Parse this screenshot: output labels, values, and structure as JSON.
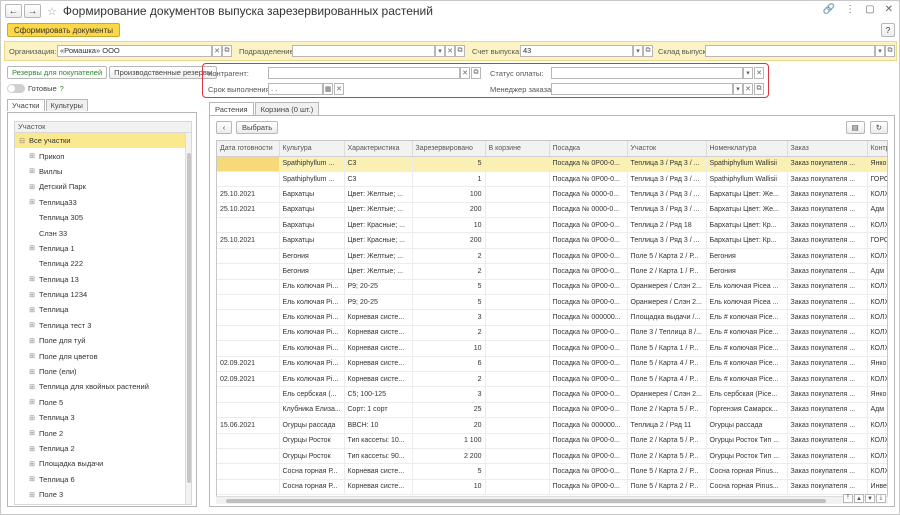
{
  "window": {
    "title": "Формирование документов выпуска зарезервированных растений",
    "back_icon": "←",
    "forward_icon": "→"
  },
  "toolbar": {
    "generate_label": "Сформировать документы",
    "help_label": "?"
  },
  "filters": {
    "org_label": "Организация:",
    "org_value": "«Ромашка» ООО",
    "dept_label": "Подразделение:",
    "dept_value": "",
    "account_label": "Счет выпуска:",
    "account_value": "43",
    "warehouse_label": "Склад выпуска:",
    "warehouse_value": ""
  },
  "left": {
    "tab_reserves": "Резервы для покупателей",
    "tab_production": "Производственные резервы",
    "ready_label": "Готовые",
    "ready_help": "?",
    "subtab_plots": "Участки",
    "subtab_crops": "Культуры",
    "tree_header": "Участок",
    "tree": [
      {
        "label": "Все участки",
        "level": 0,
        "expand": "⊟"
      },
      {
        "label": "Прикоп",
        "level": 1,
        "expand": "⊞"
      },
      {
        "label": "Виллы",
        "level": 1,
        "expand": "⊞"
      },
      {
        "label": "Детский Парк",
        "level": 1,
        "expand": "⊞"
      },
      {
        "label": "Теплица33",
        "level": 1,
        "expand": "⊞"
      },
      {
        "label": "Теплица 305",
        "level": 1,
        "expand": ""
      },
      {
        "label": "Слэн 33",
        "level": 1,
        "expand": ""
      },
      {
        "label": "Теплица 1",
        "level": 1,
        "expand": "⊞"
      },
      {
        "label": "Теплица 222",
        "level": 1,
        "expand": ""
      },
      {
        "label": "Теплица 13",
        "level": 1,
        "expand": "⊞"
      },
      {
        "label": "Теплица 1234",
        "level": 1,
        "expand": "⊞"
      },
      {
        "label": "Теплица",
        "level": 1,
        "expand": "⊞"
      },
      {
        "label": "Теплица  тест 3",
        "level": 1,
        "expand": "⊞"
      },
      {
        "label": "Поле для туй",
        "level": 1,
        "expand": "⊞"
      },
      {
        "label": "Поле для цветов",
        "level": 1,
        "expand": "⊞"
      },
      {
        "label": "Поле (ели)",
        "level": 1,
        "expand": "⊞"
      },
      {
        "label": "Теплица для хвойных растений",
        "level": 1,
        "expand": "⊞"
      },
      {
        "label": "Поле 5",
        "level": 1,
        "expand": "⊞"
      },
      {
        "label": "Теплица 3",
        "level": 1,
        "expand": "⊞"
      },
      {
        "label": "Поле 2",
        "level": 1,
        "expand": "⊞"
      },
      {
        "label": "Теплица 2",
        "level": 1,
        "expand": "⊞"
      },
      {
        "label": "Площадка выдачи",
        "level": 1,
        "expand": "⊞"
      },
      {
        "label": "Теплица 6",
        "level": 1,
        "expand": "⊞"
      },
      {
        "label": "Поле 3",
        "level": 1,
        "expand": "⊞"
      }
    ]
  },
  "contact": {
    "counterparty_label": "Контрагент:",
    "counterparty_value": "",
    "deadline_label": "Срок выполнения:",
    "deadline_value": "  .  .    ",
    "payment_label": "Статус оплаты:",
    "payment_value": "",
    "manager_label": "Менеджер заказа:",
    "manager_value": ""
  },
  "right": {
    "tab_plants": "Растения",
    "tab_cart": "Корзина (0 шт.)",
    "select_label": "Выбрать",
    "columns": [
      "Дата готовности",
      "Культура",
      "Характеристика",
      "Зарезервировано",
      "В корзине",
      "Посадка",
      "Участок",
      "Номенклатура",
      "Заказ",
      "Контр"
    ],
    "rows": [
      [
        "",
        "Spathiphyllum ...",
        "C3",
        "5",
        "",
        "Посадка № 0Р00-0...",
        "Теплица 3 / Ряд 3 / ...",
        "Spathiphyllum Wallisii",
        "Заказ покупателя ...",
        "Янко"
      ],
      [
        "",
        "Spathiphyllum ...",
        "C3",
        "1",
        "",
        "Посадка № 0Р00-0...",
        "Теплица 3 / Ряд 3 / ...",
        "Spathiphyllum Wallisii",
        "Заказ покупателя ...",
        "ГОРО"
      ],
      [
        "25.10.2021",
        "Бархатцы",
        "Цвет: Желтые; ...",
        "100",
        "",
        "Посадка № 0000-0...",
        "Теплица 3 / Ряд 3 / ...",
        "Бархатцы Цвет: Же...",
        "Заказ покупателя ...",
        "КОЛХ"
      ],
      [
        "25.10.2021",
        "Бархатцы",
        "Цвет: Желтые; ...",
        "200",
        "",
        "Посадка № 0000-0...",
        "Теплица 3 / Ряд 3 / ...",
        "Бархатцы Цвет: Же...",
        "Заказ покупателя ...",
        "Адм"
      ],
      [
        "",
        "Бархатцы",
        "Цвет: Красные; ...",
        "10",
        "",
        "Посадка № 0Р00-0...",
        "Теплица 2 / Ряд 18",
        "Бархатцы Цвет: Кр...",
        "Заказ покупателя ...",
        "КОЛХ"
      ],
      [
        "25.10.2021",
        "Бархатцы",
        "Цвет: Красные; ...",
        "200",
        "",
        "Посадка № 0Р00-0...",
        "Теплица 3 / Ряд 3 / ...",
        "Бархатцы Цвет: Кр...",
        "Заказ покупателя ...",
        "ГОРО"
      ],
      [
        "",
        "Бегония",
        "Цвет: Желтые; ...",
        "2",
        "",
        "Посадка № 0Р00-0...",
        "Поле 5 / Карта 2 / Р...",
        "Бегония",
        "Заказ покупателя ...",
        "КОЛХ"
      ],
      [
        "",
        "Бегония",
        "Цвет: Желтые; ...",
        "2",
        "",
        "Посадка № 0Р00-0...",
        "Поле 2 / Карта 1 / Р...",
        "Бегония",
        "Заказ покупателя ...",
        "Адм"
      ],
      [
        "",
        "Ель колючая Pi...",
        "P9; 20-25",
        "5",
        "",
        "Посадка № 0Р00-0...",
        "Оранжерея / Слэн 2...",
        "Ель колючая Picea ...",
        "Заказ покупателя ...",
        "КОЛХ"
      ],
      [
        "",
        "Ель колючая Pi...",
        "P9; 20-25",
        "5",
        "",
        "Посадка № 0Р00-0...",
        "Оранжерея / Слэн 2...",
        "Ель колючая Picea ...",
        "Заказ покупателя ...",
        "КОЛХ"
      ],
      [
        "",
        "Ель колючая Pi...",
        "Корневая систе...",
        "3",
        "",
        "Посадка № 000000...",
        "Площадка выдачи /...",
        "Ель # колючая Pice...",
        "Заказ покупателя ...",
        "КОЛХ"
      ],
      [
        "",
        "Ель колючая Pi...",
        "Корневая систе...",
        "2",
        "",
        "Посадка № 0Р00-0...",
        "Поле 3 / Теплица 8 /...",
        "Ель # колючая Pice...",
        "Заказ покупателя ...",
        "КОЛХ"
      ],
      [
        "",
        "Ель колючая Pi...",
        "Корневая систе...",
        "10",
        "",
        "Посадка № 0Р00-0...",
        "Поле 5 / Карта 1 / Р...",
        "Ель # колючая Pice...",
        "Заказ покупателя ...",
        "КОЛХ"
      ],
      [
        "02.09.2021",
        "Ель колючая Pi...",
        "Корневая систе...",
        "6",
        "",
        "Посадка № 0Р00-0...",
        "Поле 5 / Карта 4 / Р...",
        "Ель # колючая Pice...",
        "Заказ покупателя ...",
        "Янко"
      ],
      [
        "02.09.2021",
        "Ель колючая Pi...",
        "Корневая систе...",
        "2",
        "",
        "Посадка № 0Р00-0...",
        "Поле 5 / Карта 4 / Р...",
        "Ель # колючая Pice...",
        "Заказ покупателя ...",
        "КОЛХ"
      ],
      [
        "",
        "Ель сербская (...",
        "C5; 100-125",
        "3",
        "",
        "Посадка № 0Р00-0...",
        "Оранжерея / Слэн 2...",
        "Ель сербская (Pice...",
        "Заказ покупателя ...",
        "Янко"
      ],
      [
        "",
        "Клубника Елиза...",
        "Сорт: 1 сорт",
        "25",
        "",
        "Посадка № 0Р00-0...",
        "Поле 2 / Карта 5 / Р...",
        "Горгензия Самарск...",
        "Заказ покупателя ...",
        "Адм"
      ],
      [
        "15.06.2021",
        "Огурцы рассада",
        "ВВСН: 10",
        "20",
        "",
        "Посадка № 000000...",
        "Теплица 2 / Ряд 11",
        "Огурцы рассада",
        "Заказ покупателя ...",
        "КОЛХ"
      ],
      [
        "",
        "Огурцы Росток",
        "Тип кассеты: 10...",
        "1 100",
        "",
        "Посадка № 0Р00-0...",
        "Поле 2 / Карта 5 / Р...",
        "Огурцы Росток Тип ...",
        "Заказ покупателя ...",
        "КОЛХ"
      ],
      [
        "",
        "Огурцы Росток",
        "Тип кассеты: 90...",
        "2 200",
        "",
        "Посадка № 0Р00-0...",
        "Поле 2 / Карта 5 / Р...",
        "Огурцы Росток Тип ...",
        "Заказ покупателя ...",
        "КОЛХ"
      ],
      [
        "",
        "Сосна горная Р...",
        "Корневая систе...",
        "5",
        "",
        "Посадка № 0Р00-0...",
        "Поле 5 / Карта 2 / Р...",
        "Сосна горная Pinus...",
        "Заказ покупателя ...",
        "КОЛХ"
      ],
      [
        "",
        "Сосна горная Р...",
        "Корневая систе...",
        "10",
        "",
        "Посадка № 0Р00-0...",
        "Поле 5 / Карта 2 / Р...",
        "Сосна горная Pinus...",
        "Заказ покупателя ...",
        "Инве"
      ]
    ]
  }
}
